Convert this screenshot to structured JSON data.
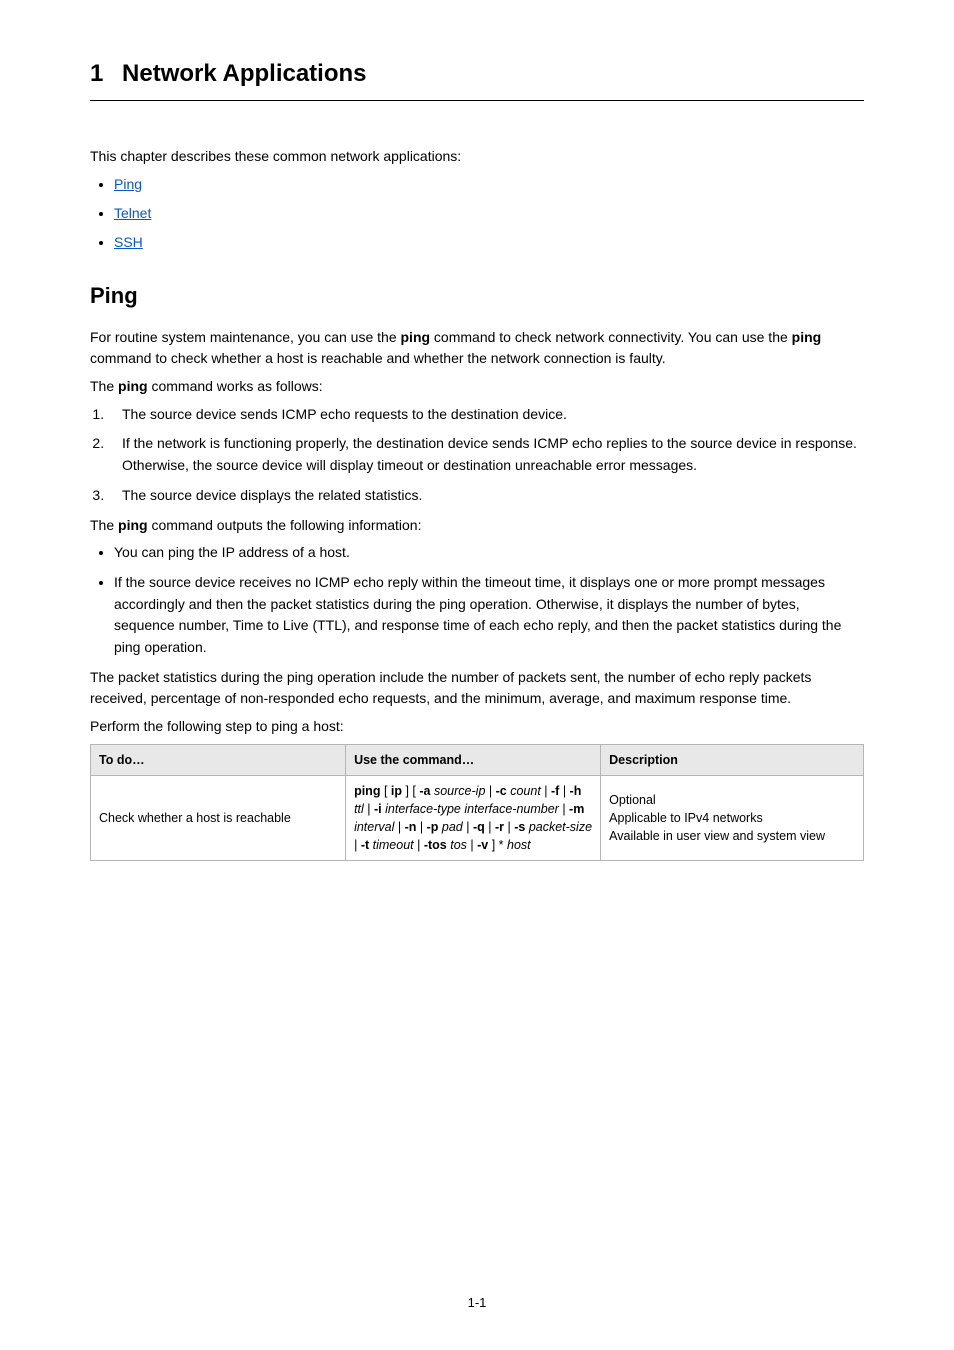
{
  "chapter": {
    "num": "1",
    "title": "Network Applications"
  },
  "intro": "This chapter describes these common network applications:",
  "links": {
    "ping": "Ping",
    "telnet": "Telnet",
    "ssh": "SSH"
  },
  "section": {
    "ping_title": "Ping"
  },
  "p1a": "For routine system maintenance, you can use the ",
  "p1b": " command to check network connectivity. You can use the ",
  "p1c": " command to check whether a host is reachable and whether the network connection is faulty.",
  "p2a": "The ",
  "p2b": " command works as follows:",
  "steps": {
    "s1": "The source device sends ICMP echo requests to the destination device.",
    "s2": "If the network is functioning properly, the destination device sends ICMP echo replies to the source device in response. Otherwise, the source device will display timeout or destination unreachable error messages.",
    "s3": "The source device displays the related statistics."
  },
  "p3a": "The ",
  "p3b": " command outputs the following information:",
  "out": {
    "b1": "You can ping the IP address of a host.",
    "b2": "If the source device receives no ICMP echo reply within the timeout time, it displays one or more prompt messages accordingly and then the packet statistics during the ping operation. Otherwise, it displays the number of bytes, sequence number, Time to Live (TTL), and response time of each echo reply, and then the packet statistics during the ping operation."
  },
  "p4": "The packet statistics during the ping operation include the number of packets sent, the number of echo reply packets received, percentage of non-responded echo requests, and the minimum, average, and maximum response time.",
  "p5": "Perform the following step to ping a host:",
  "table": {
    "h1": "To do…",
    "h2": "Use the command…",
    "h3": "Description",
    "r1c1": "Check whether a host is reachable",
    "cmd": {
      "ping": "ping",
      "ip": "ip",
      "dash_a": "-a",
      "src_ip": "source-ip",
      "dash_c": "-c",
      "count": "count",
      "dash_f": "-f",
      "dash_h": "-h",
      "ttl": "ttl",
      "dash_i": "-i",
      "iface": "interface-type interface-number",
      "dash_m": "-m",
      "interval": "interval",
      "dash_n": "-n",
      "dash_p": "-p",
      "pad": "pad",
      "dash_q": "-q",
      "dash_r": "-r",
      "dash_s": "-s",
      "pktsize": "packet-size",
      "dash_t": "-t",
      "timeout": "timeout",
      "dash_tos": "-tos",
      "tos": "tos",
      "dash_v": "-v",
      "marker": "*",
      "host": "host"
    },
    "desc1": "Optional",
    "desc2": "Applicable to IPv4 networks",
    "desc3": "Available in user view and system view"
  },
  "inline_cmd": "ping",
  "page_num": "1-1"
}
